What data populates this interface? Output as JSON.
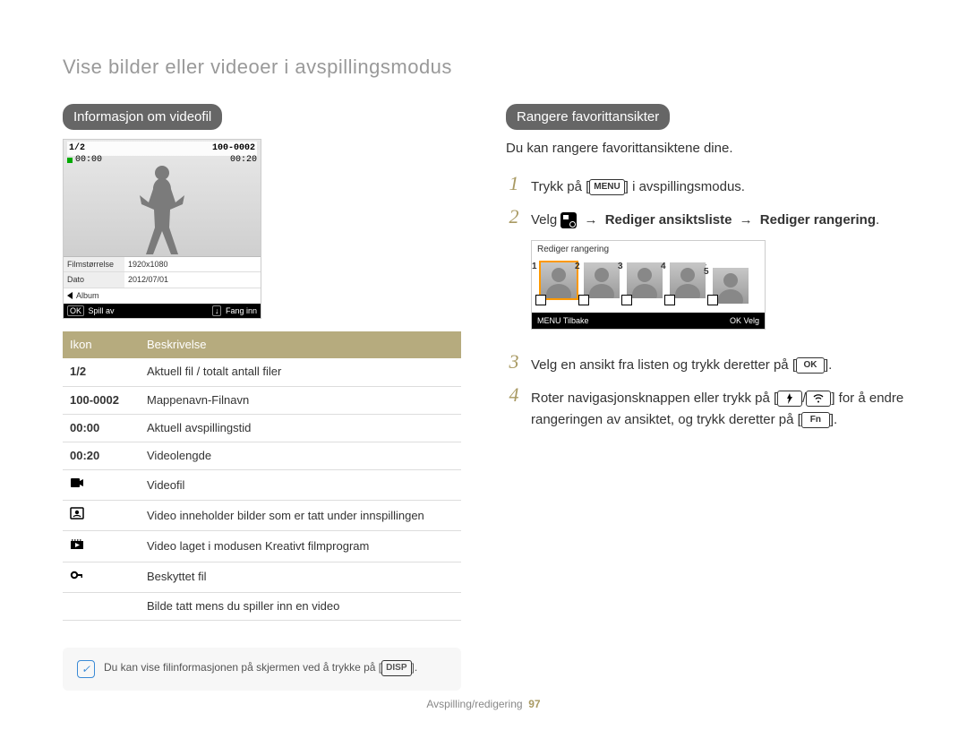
{
  "pageTitle": "Vise bilder eller videoer i avspillingsmodus",
  "left": {
    "heading": "Informasjon om videofil",
    "lcd": {
      "counter": "1/2",
      "fileId": "100-0002",
      "timeStart": "00:00",
      "timeEnd": "00:20",
      "infoRows": {
        "sizeLabel": "Filmstørrelse",
        "sizeValue": "1920x1080",
        "dateLabel": "Dato",
        "dateValue": "2012/07/01"
      },
      "albumLabel": "Album",
      "bottom": {
        "leftBtn": "OK",
        "leftLabel": "Spill av",
        "rightBtn": "↓",
        "rightLabel": "Fang inn"
      }
    },
    "table": {
      "hIcon": "Ikon",
      "hDesc": "Beskrivelse",
      "rows": {
        "r1": {
          "icon": "1/2",
          "desc": "Aktuell fil / totalt antall filer"
        },
        "r2": {
          "icon": "100-0002",
          "desc": "Mappenavn-Filnavn"
        },
        "r3": {
          "icon": "00:00",
          "desc": "Aktuell avspillingstid"
        },
        "r4": {
          "icon": "00:20",
          "desc": "Videolengde"
        },
        "r5": {
          "desc": "Videofil"
        },
        "r6": {
          "desc": "Video inneholder bilder som er tatt under innspillingen"
        },
        "r7": {
          "desc": "Video laget i modusen Kreativt filmprogram"
        },
        "r8": {
          "desc": "Beskyttet fil"
        },
        "r9": {
          "desc": "Bilde tatt mens du spiller inn en video"
        }
      }
    },
    "note": "Du kan vise filinformasjonen på skjermen ved å trykke på [",
    "noteEnd": "]."
  },
  "right": {
    "heading": "Rangere favorittansikter",
    "intro": "Du kan rangere favorittansiktene dine.",
    "step1a": "Trykk på [",
    "step1b": "] i avspillingsmodus.",
    "step2a": "Velg ",
    "step2b1": "Rediger ansiktsliste",
    "step2b2": "Rediger rangering",
    "rankTitle": "Rediger rangering",
    "rankBottom": {
      "lBtn": "MENU",
      "l": "Tilbake",
      "rBtn": "OK",
      "r": "Velg"
    },
    "step3a": "Velg en ansikt fra listen og trykk deretter på [",
    "step3b": "].",
    "step4a": "Roter navigasjonsknappen eller trykk på [",
    "step4b": "] for å endre rangeringen av ansiktet, og trykk deretter på [",
    "step4c": "]."
  },
  "kbd": {
    "menu": "MENU",
    "ok": "OK",
    "disp": "DISP",
    "fn": "Fn"
  },
  "footer": {
    "section": "Avspilling/redigering",
    "page": "97"
  }
}
